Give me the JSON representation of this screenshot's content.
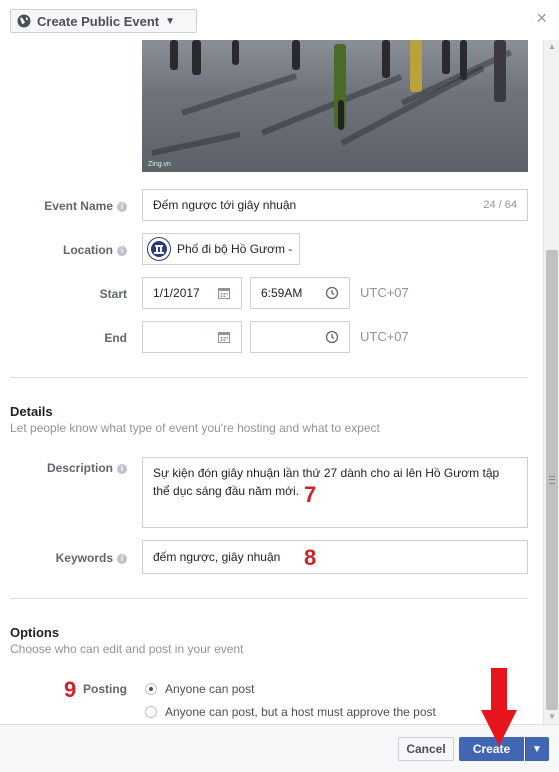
{
  "header": {
    "privacy_label": "Create Public Event",
    "close_label": "×"
  },
  "cover": {
    "watermark": "Zing.vn"
  },
  "form": {
    "event_name": {
      "label": "Event Name",
      "value": "Đếm ngược tới giây nhuận",
      "counter": "24 / 64"
    },
    "location": {
      "label": "Location",
      "value": "Phố đi bộ Hồ Gươm -"
    },
    "start": {
      "label": "Start",
      "date": "1/1/2017",
      "time": "6:59AM",
      "timezone": "UTC+07"
    },
    "end": {
      "label": "End",
      "date": "",
      "time": "",
      "timezone": "UTC+07"
    }
  },
  "details": {
    "title": "Details",
    "subtitle": "Let people know what type of event you're hosting and what to expect",
    "description": {
      "label": "Description",
      "value": "Sự kiện đón giây nhuận lần thứ 27 dành cho ai lên Hồ Gươm tập thể dục sáng đầu năm mới."
    },
    "keywords": {
      "label": "Keywords",
      "value": "đếm ngược, giây nhuận"
    }
  },
  "options": {
    "title": "Options",
    "subtitle": "Choose who can edit and post in your event",
    "posting": {
      "label": "Posting",
      "choices": [
        {
          "label": "Anyone can post",
          "selected": true
        },
        {
          "label": "Anyone can post, but a host must approve the post",
          "selected": false
        }
      ]
    }
  },
  "annotations": {
    "step7": "7",
    "step8": "8",
    "step9": "9"
  },
  "footer": {
    "cancel_label": "Cancel",
    "create_label": "Create"
  },
  "colors": {
    "primary": "#4267b2",
    "annotation_red": "#d0202a"
  },
  "icons": {
    "globe": "globe-icon",
    "calendar": "calendar-icon",
    "clock": "clock-icon",
    "info": "info-icon",
    "caret": "caret-down-icon"
  }
}
